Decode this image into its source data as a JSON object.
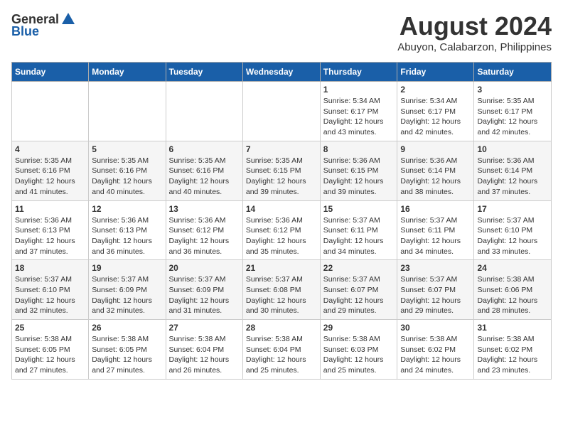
{
  "logo": {
    "general": "General",
    "blue": "Blue"
  },
  "title": {
    "month_year": "August 2024",
    "location": "Abuyon, Calabarzon, Philippines"
  },
  "headers": [
    "Sunday",
    "Monday",
    "Tuesday",
    "Wednesday",
    "Thursday",
    "Friday",
    "Saturday"
  ],
  "weeks": [
    [
      {
        "day": "",
        "info": ""
      },
      {
        "day": "",
        "info": ""
      },
      {
        "day": "",
        "info": ""
      },
      {
        "day": "",
        "info": ""
      },
      {
        "day": "1",
        "info": "Sunrise: 5:34 AM\nSunset: 6:17 PM\nDaylight: 12 hours\nand 43 minutes."
      },
      {
        "day": "2",
        "info": "Sunrise: 5:34 AM\nSunset: 6:17 PM\nDaylight: 12 hours\nand 42 minutes."
      },
      {
        "day": "3",
        "info": "Sunrise: 5:35 AM\nSunset: 6:17 PM\nDaylight: 12 hours\nand 42 minutes."
      }
    ],
    [
      {
        "day": "4",
        "info": "Sunrise: 5:35 AM\nSunset: 6:16 PM\nDaylight: 12 hours\nand 41 minutes."
      },
      {
        "day": "5",
        "info": "Sunrise: 5:35 AM\nSunset: 6:16 PM\nDaylight: 12 hours\nand 40 minutes."
      },
      {
        "day": "6",
        "info": "Sunrise: 5:35 AM\nSunset: 6:16 PM\nDaylight: 12 hours\nand 40 minutes."
      },
      {
        "day": "7",
        "info": "Sunrise: 5:35 AM\nSunset: 6:15 PM\nDaylight: 12 hours\nand 39 minutes."
      },
      {
        "day": "8",
        "info": "Sunrise: 5:36 AM\nSunset: 6:15 PM\nDaylight: 12 hours\nand 39 minutes."
      },
      {
        "day": "9",
        "info": "Sunrise: 5:36 AM\nSunset: 6:14 PM\nDaylight: 12 hours\nand 38 minutes."
      },
      {
        "day": "10",
        "info": "Sunrise: 5:36 AM\nSunset: 6:14 PM\nDaylight: 12 hours\nand 37 minutes."
      }
    ],
    [
      {
        "day": "11",
        "info": "Sunrise: 5:36 AM\nSunset: 6:13 PM\nDaylight: 12 hours\nand 37 minutes."
      },
      {
        "day": "12",
        "info": "Sunrise: 5:36 AM\nSunset: 6:13 PM\nDaylight: 12 hours\nand 36 minutes."
      },
      {
        "day": "13",
        "info": "Sunrise: 5:36 AM\nSunset: 6:12 PM\nDaylight: 12 hours\nand 36 minutes."
      },
      {
        "day": "14",
        "info": "Sunrise: 5:36 AM\nSunset: 6:12 PM\nDaylight: 12 hours\nand 35 minutes."
      },
      {
        "day": "15",
        "info": "Sunrise: 5:37 AM\nSunset: 6:11 PM\nDaylight: 12 hours\nand 34 minutes."
      },
      {
        "day": "16",
        "info": "Sunrise: 5:37 AM\nSunset: 6:11 PM\nDaylight: 12 hours\nand 34 minutes."
      },
      {
        "day": "17",
        "info": "Sunrise: 5:37 AM\nSunset: 6:10 PM\nDaylight: 12 hours\nand 33 minutes."
      }
    ],
    [
      {
        "day": "18",
        "info": "Sunrise: 5:37 AM\nSunset: 6:10 PM\nDaylight: 12 hours\nand 32 minutes."
      },
      {
        "day": "19",
        "info": "Sunrise: 5:37 AM\nSunset: 6:09 PM\nDaylight: 12 hours\nand 32 minutes."
      },
      {
        "day": "20",
        "info": "Sunrise: 5:37 AM\nSunset: 6:09 PM\nDaylight: 12 hours\nand 31 minutes."
      },
      {
        "day": "21",
        "info": "Sunrise: 5:37 AM\nSunset: 6:08 PM\nDaylight: 12 hours\nand 30 minutes."
      },
      {
        "day": "22",
        "info": "Sunrise: 5:37 AM\nSunset: 6:07 PM\nDaylight: 12 hours\nand 29 minutes."
      },
      {
        "day": "23",
        "info": "Sunrise: 5:37 AM\nSunset: 6:07 PM\nDaylight: 12 hours\nand 29 minutes."
      },
      {
        "day": "24",
        "info": "Sunrise: 5:38 AM\nSunset: 6:06 PM\nDaylight: 12 hours\nand 28 minutes."
      }
    ],
    [
      {
        "day": "25",
        "info": "Sunrise: 5:38 AM\nSunset: 6:05 PM\nDaylight: 12 hours\nand 27 minutes."
      },
      {
        "day": "26",
        "info": "Sunrise: 5:38 AM\nSunset: 6:05 PM\nDaylight: 12 hours\nand 27 minutes."
      },
      {
        "day": "27",
        "info": "Sunrise: 5:38 AM\nSunset: 6:04 PM\nDaylight: 12 hours\nand 26 minutes."
      },
      {
        "day": "28",
        "info": "Sunrise: 5:38 AM\nSunset: 6:04 PM\nDaylight: 12 hours\nand 25 minutes."
      },
      {
        "day": "29",
        "info": "Sunrise: 5:38 AM\nSunset: 6:03 PM\nDaylight: 12 hours\nand 25 minutes."
      },
      {
        "day": "30",
        "info": "Sunrise: 5:38 AM\nSunset: 6:02 PM\nDaylight: 12 hours\nand 24 minutes."
      },
      {
        "day": "31",
        "info": "Sunrise: 5:38 AM\nSunset: 6:02 PM\nDaylight: 12 hours\nand 23 minutes."
      }
    ]
  ]
}
